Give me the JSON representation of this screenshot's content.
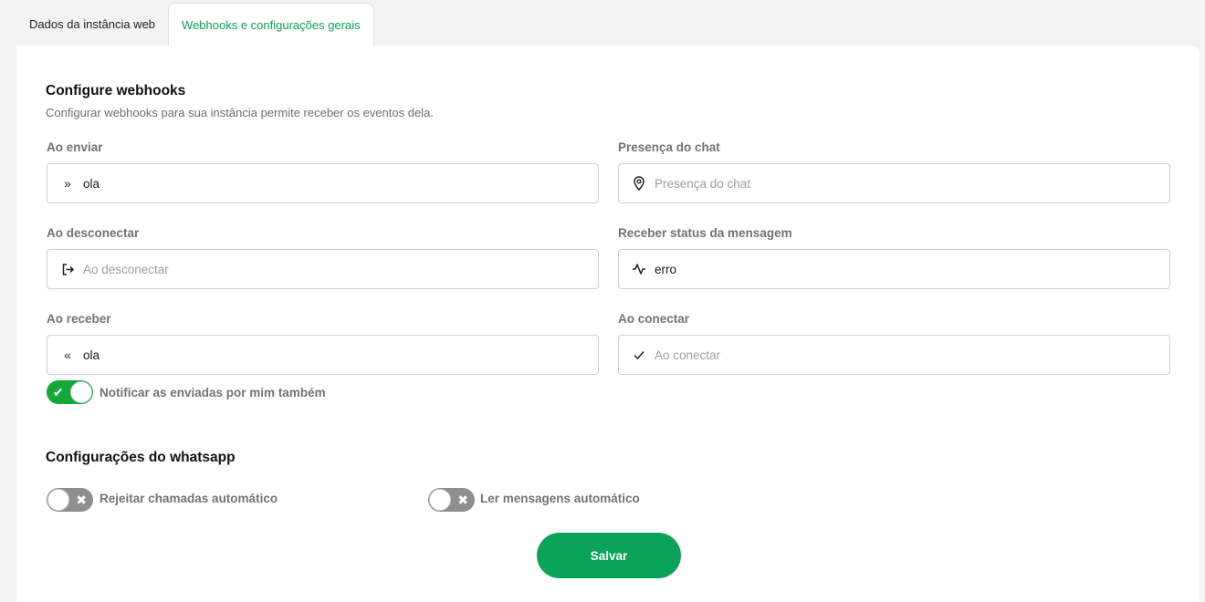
{
  "tabs": [
    {
      "label": "Dados da instância web",
      "active": false
    },
    {
      "label": "Webhooks e configurações gerais",
      "active": true
    }
  ],
  "webhooks": {
    "title": "Configure webhooks",
    "subtitle": "Configurar webhooks para sua instância permite receber os eventos dela.",
    "fields": {
      "on_send": {
        "label": "Ao enviar",
        "value": "ola",
        "placeholder": "Ao enviar",
        "icon": "double-chevron-right-icon"
      },
      "chat_presence": {
        "label": "Presença do chat",
        "value": "",
        "placeholder": "Presença do chat",
        "icon": "map-pin-icon"
      },
      "on_disconnect": {
        "label": "Ao desconectar",
        "value": "",
        "placeholder": "Ao desconectar",
        "icon": "logout-icon"
      },
      "message_status": {
        "label": "Receber status da mensagem",
        "value": "erro",
        "placeholder": "Receber status da mensagem",
        "icon": "activity-icon"
      },
      "on_receive": {
        "label": "Ao receber",
        "value": "ola",
        "placeholder": "Ao receber",
        "icon": "double-chevron-left-icon"
      },
      "on_connect": {
        "label": "Ao conectar",
        "value": "",
        "placeholder": "Ao conectar",
        "icon": "check-icon"
      }
    },
    "notify_sent_by_me": {
      "label": "Notificar as enviadas por mim também",
      "enabled": true
    }
  },
  "whatsapp": {
    "title": "Configurações do whatsapp",
    "reject_calls": {
      "label": "Rejeitar chamadas automático",
      "enabled": false
    },
    "auto_read": {
      "label": "Ler mensagens automático",
      "enabled": false
    }
  },
  "save_label": "Salvar",
  "colors": {
    "accent": "#0aa357",
    "toggle_on": "#14a83a",
    "toggle_off": "#8f8f8f"
  }
}
